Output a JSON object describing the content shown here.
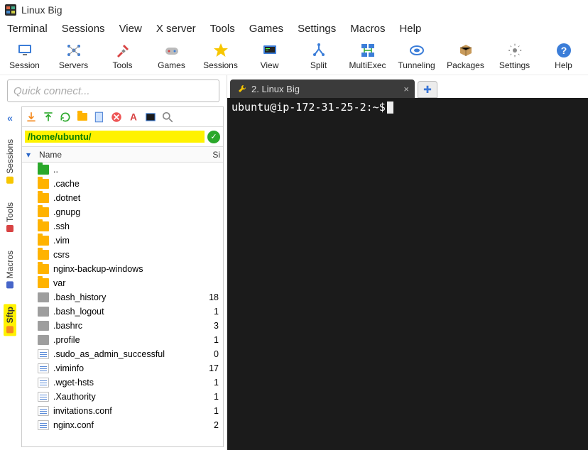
{
  "window": {
    "title": "Linux Big"
  },
  "menubar": [
    "Terminal",
    "Sessions",
    "View",
    "X server",
    "Tools",
    "Games",
    "Settings",
    "Macros",
    "Help"
  ],
  "toolbar": [
    {
      "name": "session",
      "label": "Session",
      "icon": "session"
    },
    {
      "name": "servers",
      "label": "Servers",
      "icon": "servers"
    },
    {
      "name": "tools",
      "label": "Tools",
      "icon": "tools"
    },
    {
      "name": "games",
      "label": "Games",
      "icon": "games"
    },
    {
      "name": "sessions",
      "label": "Sessions",
      "icon": "sessions"
    },
    {
      "name": "view",
      "label": "View",
      "icon": "view"
    },
    {
      "name": "split",
      "label": "Split",
      "icon": "split"
    },
    {
      "name": "multiexec",
      "label": "MultiExec",
      "icon": "multiexec"
    },
    {
      "name": "tunneling",
      "label": "Tunneling",
      "icon": "tunneling"
    },
    {
      "name": "packages",
      "label": "Packages",
      "icon": "packages"
    },
    {
      "name": "settings",
      "label": "Settings",
      "icon": "settings"
    },
    {
      "name": "help",
      "label": "Help",
      "icon": "help"
    }
  ],
  "quick_connect": {
    "placeholder": "Quick connect..."
  },
  "sidetabs": [
    {
      "name": "sessions",
      "label": "Sessions",
      "color": "#f7c600"
    },
    {
      "name": "tools",
      "label": "Tools",
      "color": "#d84343"
    },
    {
      "name": "macros",
      "label": "Macros",
      "color": "#4766c9"
    },
    {
      "name": "sftp",
      "label": "Sftp",
      "color": "#f58a1f",
      "active": true
    }
  ],
  "sftp": {
    "path": "/home/ubuntu/",
    "columns": {
      "name": "Name",
      "size": "Si"
    },
    "files": [
      {
        "icon": "folder-g",
        "name": "..",
        "size": ""
      },
      {
        "icon": "folder-y",
        "name": ".cache",
        "size": ""
      },
      {
        "icon": "folder-y",
        "name": ".dotnet",
        "size": ""
      },
      {
        "icon": "folder-y",
        "name": ".gnupg",
        "size": ""
      },
      {
        "icon": "folder-y",
        "name": ".ssh",
        "size": ""
      },
      {
        "icon": "folder-y",
        "name": ".vim",
        "size": ""
      },
      {
        "icon": "folder-y",
        "name": "csrs",
        "size": ""
      },
      {
        "icon": "folder-y",
        "name": "nginx-backup-windows",
        "size": ""
      },
      {
        "icon": "folder-y",
        "name": "var",
        "size": ""
      },
      {
        "icon": "file-gr",
        "name": ".bash_history",
        "size": "18"
      },
      {
        "icon": "file-gr",
        "name": ".bash_logout",
        "size": "1"
      },
      {
        "icon": "file-gr",
        "name": ".bashrc",
        "size": "3"
      },
      {
        "icon": "file-gr",
        "name": ".profile",
        "size": "1"
      },
      {
        "icon": "file-wh",
        "name": ".sudo_as_admin_successful",
        "size": "0"
      },
      {
        "icon": "file-wh",
        "name": ".viminfo",
        "size": "17"
      },
      {
        "icon": "file-wh",
        "name": ".wget-hsts",
        "size": "1"
      },
      {
        "icon": "file-wh",
        "name": ".Xauthority",
        "size": "1"
      },
      {
        "icon": "file-wh",
        "name": "invitations.conf",
        "size": "1"
      },
      {
        "icon": "file-wh",
        "name": "nginx.conf",
        "size": "2"
      }
    ]
  },
  "tab": {
    "label": "2. Linux Big"
  },
  "terminal": {
    "prompt": "ubuntu@ip-172-31-25-2:~$"
  }
}
